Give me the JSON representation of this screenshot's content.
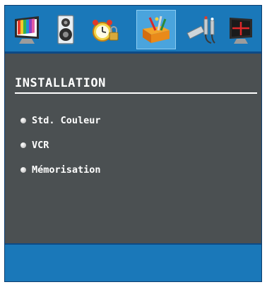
{
  "toolbar": {
    "icons": [
      {
        "name": "picture-icon",
        "active": false
      },
      {
        "name": "sound-icon",
        "active": false
      },
      {
        "name": "timer-lock-icon",
        "active": false
      },
      {
        "name": "installation-toolbox-icon",
        "active": true
      },
      {
        "name": "source-cable-icon",
        "active": false
      },
      {
        "name": "pc-display-icon",
        "active": false
      }
    ]
  },
  "panel": {
    "title": "INSTALLATION",
    "items": [
      {
        "label": "Std. Couleur"
      },
      {
        "label": "VCR"
      },
      {
        "label": "Mémorisation"
      }
    ]
  },
  "colors": {
    "toolbar_bg": "#1a78b9",
    "panel_bg": "#4b5052",
    "active_tile": "#4aa4dd",
    "text": "#ffffff"
  }
}
